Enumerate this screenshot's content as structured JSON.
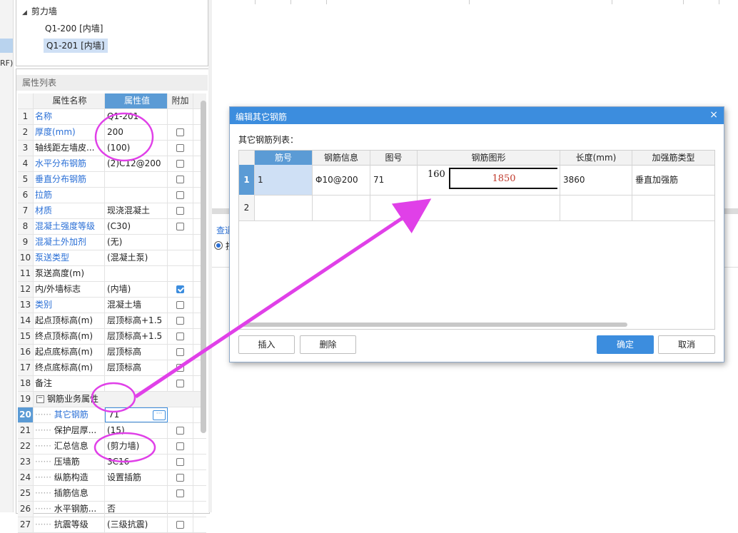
{
  "left_edge": {
    "label": "RF)"
  },
  "tree": {
    "group": "剪力墙",
    "items": [
      "Q1-200 [内墙]",
      "Q1-201 [内墙]"
    ],
    "selected_index": 1
  },
  "property_list": {
    "title": "属性列表",
    "headers": {
      "name": "属性名称",
      "value": "属性值",
      "extra": "附加"
    },
    "rows": [
      {
        "num": "1",
        "name": "名称",
        "value": "Q1-201",
        "blue": true,
        "checkbox": false,
        "checked": false
      },
      {
        "num": "2",
        "name": "厚度(mm)",
        "value": "200",
        "blue": true,
        "checkbox": true,
        "checked": false
      },
      {
        "num": "3",
        "name": "轴线距左墙皮...",
        "value": "(100)",
        "blue": false,
        "checkbox": true,
        "checked": false
      },
      {
        "num": "4",
        "name": "水平分布钢筋",
        "value": "(2)C12@200",
        "blue": true,
        "checkbox": true,
        "checked": false
      },
      {
        "num": "5",
        "name": "垂直分布钢筋",
        "value": "",
        "blue": true,
        "checkbox": true,
        "checked": false
      },
      {
        "num": "6",
        "name": "拉筋",
        "value": "",
        "blue": true,
        "checkbox": true,
        "checked": false
      },
      {
        "num": "7",
        "name": "材质",
        "value": "现浇混凝土",
        "blue": true,
        "checkbox": true,
        "checked": false
      },
      {
        "num": "8",
        "name": "混凝土强度等级",
        "value": "(C30)",
        "blue": true,
        "checkbox": true,
        "checked": false
      },
      {
        "num": "9",
        "name": "混凝土外加剂",
        "value": "(无)",
        "blue": true,
        "checkbox": false,
        "checked": false
      },
      {
        "num": "10",
        "name": "泵送类型",
        "value": "(混凝土泵)",
        "blue": true,
        "checkbox": false,
        "checked": false
      },
      {
        "num": "11",
        "name": "泵送高度(m)",
        "value": "",
        "blue": false,
        "checkbox": false,
        "checked": false
      },
      {
        "num": "12",
        "name": "内/外墙标志",
        "value": "(内墙)",
        "blue": false,
        "checkbox": true,
        "checked": true
      },
      {
        "num": "13",
        "name": "类别",
        "value": "混凝土墙",
        "blue": true,
        "checkbox": true,
        "checked": false
      },
      {
        "num": "14",
        "name": "起点顶标高(m)",
        "value": "层顶标高+1.5",
        "blue": false,
        "checkbox": true,
        "checked": false
      },
      {
        "num": "15",
        "name": "终点顶标高(m)",
        "value": "层顶标高+1.5",
        "blue": false,
        "checkbox": true,
        "checked": false
      },
      {
        "num": "16",
        "name": "起点底标高(m)",
        "value": "层顶标高",
        "blue": false,
        "checkbox": true,
        "checked": false
      },
      {
        "num": "17",
        "name": "终点底标高(m)",
        "value": "层顶标高",
        "blue": false,
        "checkbox": true,
        "checked": false
      },
      {
        "num": "18",
        "name": "备注",
        "value": "",
        "blue": false,
        "checkbox": true,
        "checked": false
      },
      {
        "num": "19",
        "name": "钢筋业务属性",
        "value": "",
        "blue": false,
        "checkbox": false,
        "checked": false,
        "group": true
      },
      {
        "num": "20",
        "name": "其它钢筋",
        "value": "71",
        "blue": true,
        "checkbox": false,
        "checked": false,
        "editing": true,
        "child": true
      },
      {
        "num": "21",
        "name": "保护层厚...",
        "value": "(15)",
        "blue": false,
        "checkbox": true,
        "checked": false,
        "child": true
      },
      {
        "num": "22",
        "name": "汇总信息",
        "value": "(剪力墙)",
        "blue": false,
        "checkbox": true,
        "checked": false,
        "child": true
      },
      {
        "num": "23",
        "name": "压墙筋",
        "value": "3C16",
        "blue": false,
        "checkbox": true,
        "checked": false,
        "child": true
      },
      {
        "num": "24",
        "name": "纵筋构造",
        "value": "设置插筋",
        "blue": false,
        "checkbox": true,
        "checked": false,
        "child": true
      },
      {
        "num": "25",
        "name": "插筋信息",
        "value": "",
        "blue": false,
        "checkbox": true,
        "checked": false,
        "child": true
      },
      {
        "num": "26",
        "name": "水平钢筋...",
        "value": "否",
        "blue": false,
        "checkbox": false,
        "checked": false,
        "child": true
      },
      {
        "num": "27",
        "name": "抗震等级",
        "value": "(三级抗震)",
        "blue": false,
        "checkbox": true,
        "checked": false,
        "child": true
      }
    ]
  },
  "right_area": {
    "query_tab": "查道"
  },
  "dialog": {
    "title": "编辑其它钢筋",
    "close_glyph": "×",
    "subtitle": "其它钢筋列表：",
    "columns": [
      "筋号",
      "钢筋信息",
      "图号",
      "钢筋图形",
      "长度(mm)",
      "加强筋类型"
    ],
    "rows": [
      {
        "num": "1",
        "bar_no": "1",
        "bar_info": "Φ10@200",
        "figure_no": "71",
        "shape_left": "160",
        "shape_main": "1850",
        "length": "3860",
        "type": "垂直加强筋"
      },
      {
        "num": "2",
        "bar_no": "",
        "bar_info": "",
        "figure_no": "",
        "shape_left": "",
        "shape_main": "",
        "length": "",
        "type": ""
      }
    ],
    "buttons": {
      "insert": "插入",
      "delete": "删除",
      "ok": "确定",
      "cancel": "取消"
    }
  },
  "colors": {
    "accent": "#3c8dde",
    "annotation": "#e040e8",
    "link_blue": "#2a6fd6"
  }
}
